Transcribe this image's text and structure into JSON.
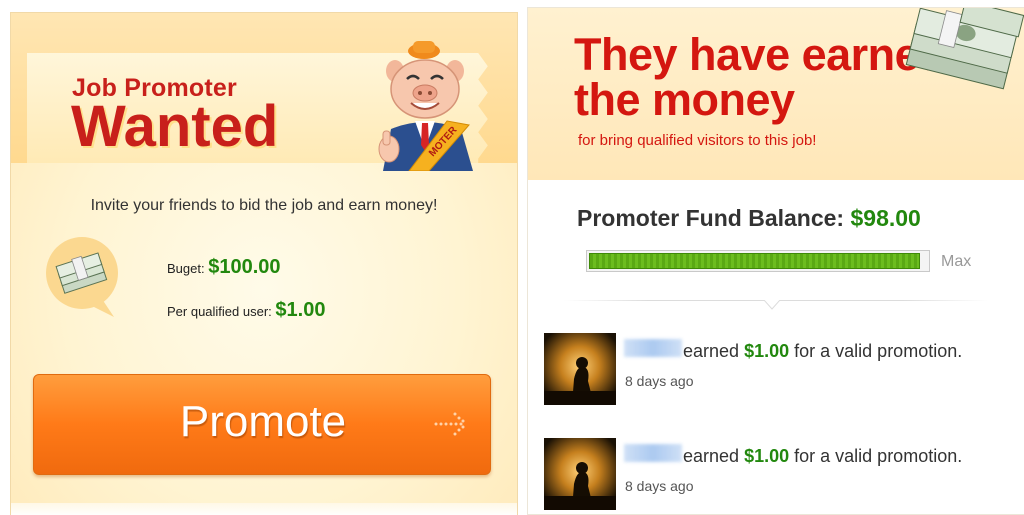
{
  "left_panel": {
    "header": {
      "line1": "Job Promoter",
      "line2": "Wanted",
      "mascot_sash_text": "MOTER"
    },
    "invite_text": "Invite your friends to bid the job and earn money!",
    "budget_label": "Buget:",
    "budget_value": "$100.00",
    "per_user_label": "Per qualified user:",
    "per_user_value": "$1.00",
    "promote_button_label": "Promote"
  },
  "right_panel": {
    "title": "They have earned the money",
    "subtitle": "for bring qualified visitors to this job!",
    "fund_label": "Promoter Fund Balance:",
    "fund_value": "$98.00",
    "fund_progress_percent": 98,
    "max_label": "Max",
    "activity": [
      {
        "action_text": "earned",
        "amount": "$1.00",
        "suffix": "for a valid promotion.",
        "time": "8 days ago"
      },
      {
        "action_text": "earned",
        "amount": "$1.00",
        "suffix": "for a valid promotion.",
        "time": "8 days ago"
      }
    ]
  },
  "colors": {
    "title_red": "#c8201b",
    "money_green": "#22880e",
    "button_orange": "#ff7a18",
    "progress_green": "#5aa914"
  },
  "icons": [
    "pig-mascot-icon",
    "money-stack-icon",
    "arrow-right-icon",
    "cash-stack-icon",
    "user-avatar-icon"
  ]
}
